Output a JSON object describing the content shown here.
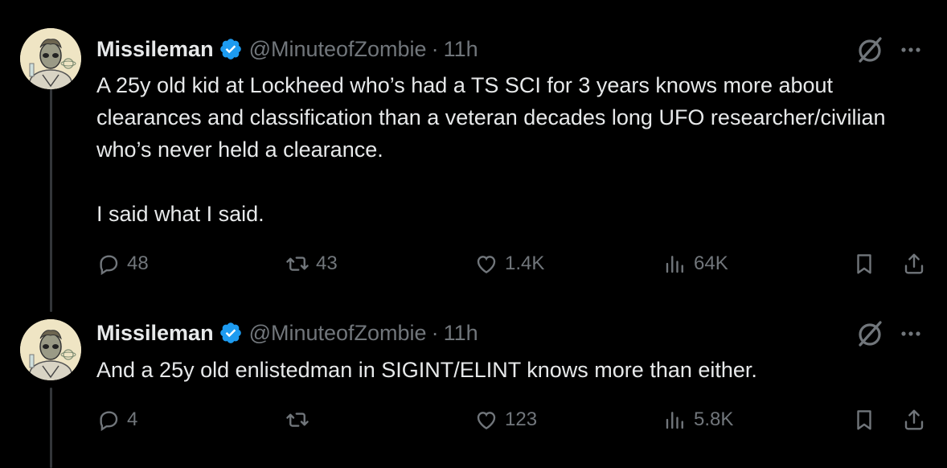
{
  "tweets": [
    {
      "name": "Missileman",
      "handle": "@MinuteofZombie",
      "separator": "·",
      "time": "11h",
      "text": "A 25y old kid at Lockheed who’s had a TS SCI for 3 years knows more about clearances and classification than a veteran decades long UFO researcher/civilian who’s never held a clearance.\n\nI said what I said.",
      "replies": "48",
      "reposts": "43",
      "likes": "1.4K",
      "views": "64K"
    },
    {
      "name": "Missileman",
      "handle": "@MinuteofZombie",
      "separator": "·",
      "time": "11h",
      "text": "And a 25y old enlistedman in SIGINT/ELINT knows more than either.",
      "replies": "4",
      "reposts": "",
      "likes": "123",
      "views": "5.8K"
    }
  ],
  "colors": {
    "background": "#000000",
    "text": "#e7e9ea",
    "muted": "#71767b",
    "verified": "#1d9bf0",
    "thread_line": "#333639"
  },
  "icons": [
    "verified-badge-icon",
    "grok-icon",
    "more-icon",
    "reply-icon",
    "repost-icon",
    "like-icon",
    "views-icon",
    "bookmark-icon",
    "share-icon"
  ]
}
